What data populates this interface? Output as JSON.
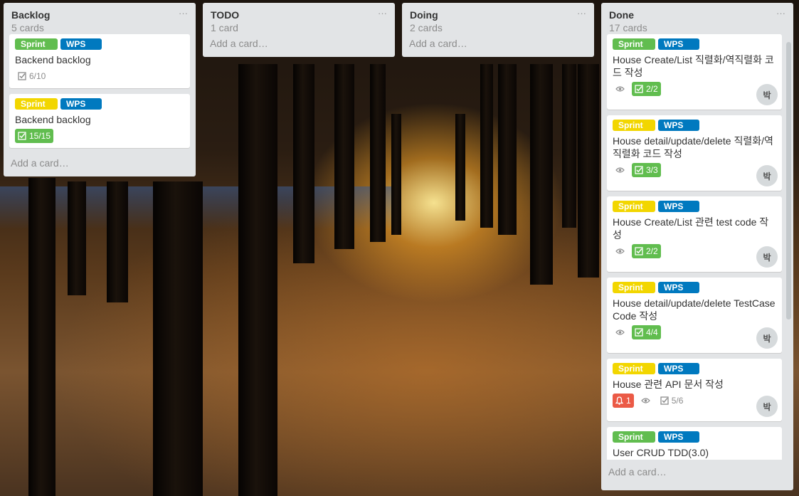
{
  "colors": {
    "green": "#61bd4f",
    "yellow": "#f2d600",
    "blue": "#0079bf",
    "red": "#eb5a46",
    "list_bg": "#e2e4e6"
  },
  "lists": [
    {
      "title": "Backlog",
      "count": "5 cards",
      "cards": [
        {
          "labels": [
            "Sprint 1",
            "WPS"
          ],
          "title": "Backend backlog",
          "checklist": "6/10"
        },
        {
          "labels": [
            "Sprint 2",
            "WPS"
          ],
          "title": "Backend backlog",
          "checklist": "15/15"
        }
      ],
      "add_card": "Add a card…"
    },
    {
      "title": "TODO",
      "count": "1 card",
      "add_card": "Add a card…"
    },
    {
      "title": "Doing",
      "count": "2 cards",
      "add_card": "Add a card…"
    },
    {
      "title": "Done",
      "count": "17 cards",
      "cards": [
        {
          "labels": [
            "Sprint 1",
            "WPS"
          ],
          "title": "House Create/List 직렬화/역직렬화 코드 작성",
          "checklist": "2/2",
          "member": "박"
        },
        {
          "labels": [
            "Sprint 2",
            "WPS"
          ],
          "title": "House detail/update/delete 직렬화/역직렬화 코드 작성",
          "checklist": "3/3",
          "member": "박"
        },
        {
          "labels": [
            "Sprint 2",
            "WPS"
          ],
          "title": "House Create/List 관련 test code 작성",
          "checklist": "2/2",
          "member": "박"
        },
        {
          "labels": [
            "Sprint 2",
            "WPS"
          ],
          "title": "House detail/update/delete TestCaseCode 작성",
          "checklist": "4/4",
          "member": "박"
        },
        {
          "labels": [
            "Sprint 2",
            "WPS"
          ],
          "title": "House 관련 API 문서 작성",
          "notifications": "1",
          "checklist": "5/6",
          "member": "박"
        },
        {
          "labels": [
            "Sprint 1",
            "WPS"
          ],
          "title": "User CRUD TDD(3.0)"
        }
      ],
      "add_card": "Add a card…"
    }
  ],
  "icons": {
    "menu": "ellipsis-icon",
    "check": "checklist-icon",
    "watch": "eye-icon",
    "bell": "bell-icon"
  }
}
